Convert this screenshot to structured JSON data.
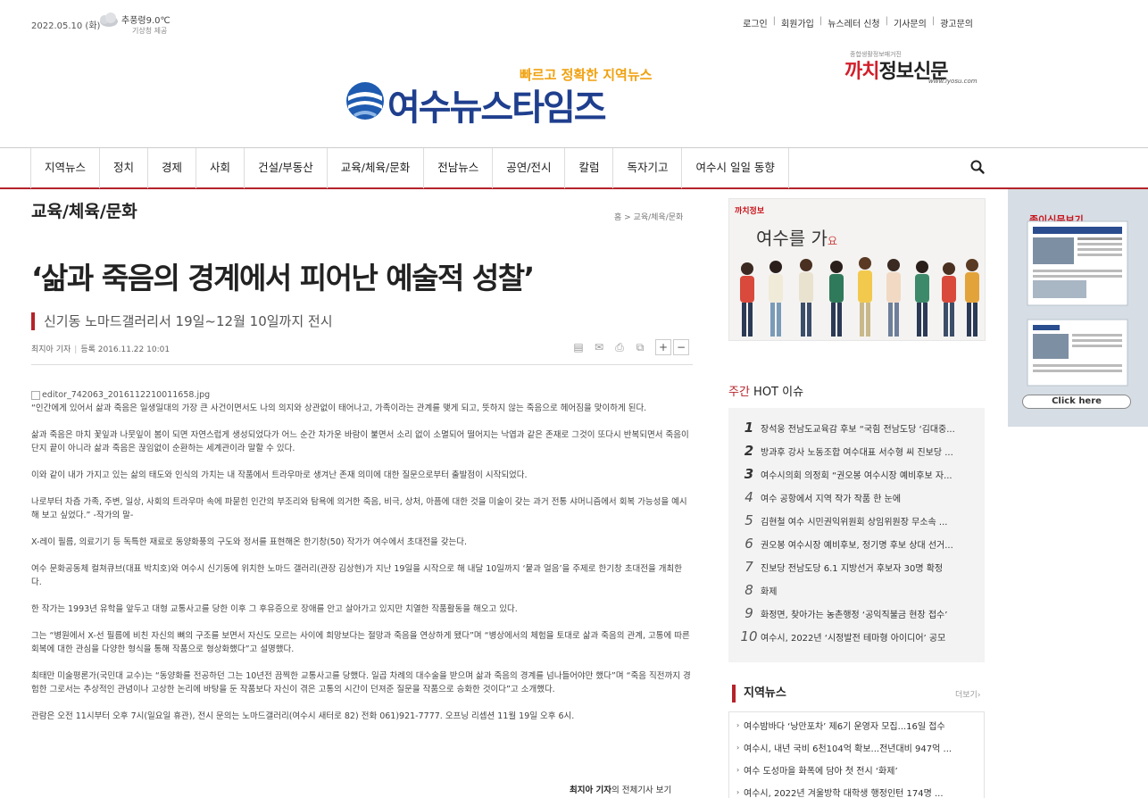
{
  "header": {
    "date": "2022.05.10 (화)",
    "weather": "추풍령9.0℃",
    "weather_source": "기상청 제공",
    "util_links": [
      "로그인",
      "회원가입",
      "뉴스레터 신청",
      "기사문의",
      "광고문의"
    ],
    "slogan": "빠르고 정확한 지역뉴스",
    "logo_text": "여수뉴스타임즈",
    "partner": {
      "small": "종합생활정보매거진",
      "main_red": "까치",
      "main_black": "정보신문",
      "url": "www.iyosu.com"
    }
  },
  "nav": {
    "items": [
      "지역뉴스",
      "정치",
      "경제",
      "사회",
      "건설/부동산",
      "교육/체육/문화",
      "전남뉴스",
      "공연/전시",
      "칼럼",
      "독자기고",
      "여수시 일일 동향"
    ],
    "search_icon": "search-icon"
  },
  "article": {
    "section": "교육/체육/문화",
    "breadcrumb": "홈 > 교육/체육/문화",
    "title": "‘삶과 죽음의 경계에서 피어난 예술적 성찰’",
    "subtitle": "신기동 노마드갤러리서 19일~12월 10일까지 전시",
    "author": "최지아 기자",
    "date_label": "등록 2016.11.22 10:01",
    "font_plus": "+",
    "font_minus": "−",
    "image_alt": "editor_742063_2016112210011658.jpg",
    "paragraphs": [
      "“인간에게 있어서 삶과 죽음은 일생일대의 가장 큰 사건이면서도 나의 의지와 상관없이 태어나고, 가족이라는 관계를 맺게 되고, 뜻하지 않는 죽음으로 헤어짐을 맞이하게 된다.",
      "삶과 죽음은 마치 꽃잎과 나뭇잎이 봄이 되면 자연스럽게 생성되었다가 어느 순간 차가운 바람이 불면서 소리 없이 소멸되어 떨어지는 낙엽과 같은 존재로 그것이 또다시 반복되면서 죽음이 단지 끝이 아니라 삶과 죽음은 끊임없이 순환하는 세계관이라 말할 수 있다.",
      "이와 같이 내가 가지고 있는 삶의 태도와 인식의 가치는 내 작품에서 트라우마로 생겨난 존재 의미에 대한 질문으로부터 출발점이 시작되었다.",
      "나로부터 차츰 가족, 주변, 일상, 사회의 트라우마 속에 파묻힌 인간의 부조리와 탐욕에 의거한 죽음, 비극, 상처, 아픔에 대한 것을 미술이 갖는 과거 전통 샤머니즘에서 회복 가능성을 예시해 보고 싶었다.” -작가의 말-",
      "X-레이 필름, 의료기기 등 독특한 재료로 동양화풍의 구도와 정서를 표현해온 한기창(50) 작가가 여수에서 초대전을 갖는다.",
      "여수 문화공동체 컬쳐큐브(대표 박치호)와 여수시 신기동에 위치한 노마드 갤러리(관장 김상현)가 지난 19일을 시작으로 해 내달  10일까지 ‘뭍과 얼음’을 주제로 한기창 초대전을 개최한다.",
      "한 작가는 1993년 유학을 앞두고 대형 교통사고를 당한 이후 그 후유증으로 장애를 안고 살아가고 있지만 치열한 작품활동을 해오고 있다.",
      "그는 “병원에서 X-선 필름에 비친 자신의 뼈의 구조를 보면서 자신도 모르는 사이에 희망보다는 절망과 죽음을 연상하게 됐다”며 “병상에서의 체험을 토대로 삶과 죽음의 관계, 고통에 따른 회복에 대한 관심을 다양한 형식을 통해 작품으로 형상화했다”고 설명했다.",
      "최태만 미술평론가(국민대 교수)는 “동양화를 전공하던 그는 10년전 끔찍한 교통사고를 당했다. 일곱 차례의 대수술을 받으며 삶과 죽음의 경계를 넘나들어야만 했다”며 “죽음 직전까지 경험한 그로서는 추상적인 관념이나 고상한 논리에 바탕을 둔 작품보다 자신이 겪은 고통의 시간이 던져준 질문을 작품으로 승화한 것이다”고 소개했다.",
      "관람은 오전 11시부터 오후 7시(일요일 휴관), 전시 문의는 노마드갤러리(여수시 새터로 82) 전화 061)921-7777. 오프닝 리셉션 11월 19일 오후 6시."
    ],
    "byline_name": "최지아 기자",
    "byline_suffix": "의 전체기사 보기"
  },
  "sidebar": {
    "ad_logo": "까치정보",
    "ad_title": "여수를 가",
    "ad_title_small": "요",
    "hot_title_red": "주간",
    "hot_title": " HOT 이슈",
    "hot_items": [
      {
        "num": "1",
        "text": "장석웅 전남도교육감 후보 “국힘 전남도당 ‘김대중..."
      },
      {
        "num": "2",
        "text": "방과후 강사 노동조합 여수대표 서수형 씨 진보당 ..."
      },
      {
        "num": "3",
        "text": "여수시의회 의정회 “권오봉 여수시장 예비후보 자..."
      },
      {
        "num": "4",
        "text": "여수 공항에서 지역 작가 작품 한 눈에"
      },
      {
        "num": "5",
        "text": "김현철 여수 시민권익위원회 상임위원장 무소속 ..."
      },
      {
        "num": "6",
        "text": "권오봉 여수시장 예비후보, 정기명 후보 상대 선거..."
      },
      {
        "num": "7",
        "text": "진보당 전남도당 6.1 지방선거 후보자 30명 확정"
      },
      {
        "num": "8",
        "text": "화제"
      },
      {
        "num": "9",
        "text": "화정면, 찾아가는 농촌행정 ‘공익직불금 현장 접수’"
      },
      {
        "num": "10",
        "text": "여수시, 2022년 ‘시정발전 테마형 아이디어’ 공모"
      }
    ],
    "local_title": "지역뉴스",
    "more": "더보기",
    "local_items": [
      "여수밤바다 ‘낭만포차’ 제6기 운영자 모집...16일 접수",
      "여수시, 내년 국비 6천104억 확보...전년대비 947억 ...",
      "여수 도성마을 화폭에 담아 첫 전시 ‘화제’",
      "여수시, 2022년 겨울방학 대학생 행정인턴 174명 ..."
    ],
    "paper_head": "종이신문보기",
    "click_here": "Click here"
  }
}
